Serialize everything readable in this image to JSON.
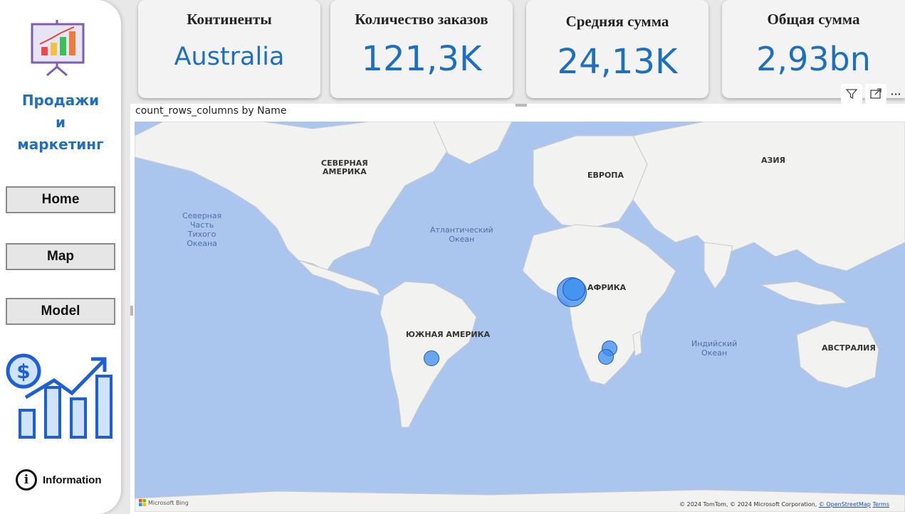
{
  "sidebar": {
    "title_lines": [
      "Продажи",
      "и",
      "маркетинг"
    ],
    "nav": [
      {
        "label": "Home"
      },
      {
        "label": "Map"
      },
      {
        "label": "Model"
      }
    ],
    "info_glyph": "i",
    "info_label": "Information",
    "icons": [
      "presentation-chart-icon",
      "finance-growth-icon",
      "info-icon"
    ]
  },
  "kpis": [
    {
      "title": "Континенты",
      "value": "Australia"
    },
    {
      "title": "Количество заказов",
      "value": "121,3K"
    },
    {
      "title": "Средняя сумма",
      "value": "24,13K"
    },
    {
      "title": "Общая сумма",
      "value": "2,93bn"
    }
  ],
  "visual": {
    "title": "count_rows_columns by Name",
    "toolbar_icons": [
      "filter-icon",
      "focus-mode-icon",
      "more-options-icon"
    ],
    "toolbar_more": "···"
  },
  "map": {
    "continent_labels": {
      "north_america": [
        "СЕВЕРНАЯ",
        "АМЕРИКА"
      ],
      "europe": "ЕВРОПА",
      "asia": "АЗИЯ",
      "africa": "АФРИКА",
      "south_america": "ЮЖНАЯ АМЕРИКА",
      "australia": "АВСТРАЛИЯ"
    },
    "ocean_labels": {
      "north_pacific": [
        "Северная",
        "Часть",
        "Тихого",
        "Океана"
      ],
      "atlantic": [
        "Атлантический",
        "Океан"
      ],
      "indian": [
        "Индийский",
        "Океан"
      ]
    },
    "bubble_color": "#3c8cf0",
    "water_color": "#aac6ef",
    "land_color": "#f2f2f0",
    "attribution": {
      "text": "© 2024 TomTom, © 2024 Microsoft Corporation,",
      "osm": "© OpenStreetMap",
      "terms": "Terms"
    },
    "bing": "Microsoft Bing"
  },
  "colors": {
    "accent": "#1f6fc0",
    "card_bg": "#f3f3f3"
  }
}
